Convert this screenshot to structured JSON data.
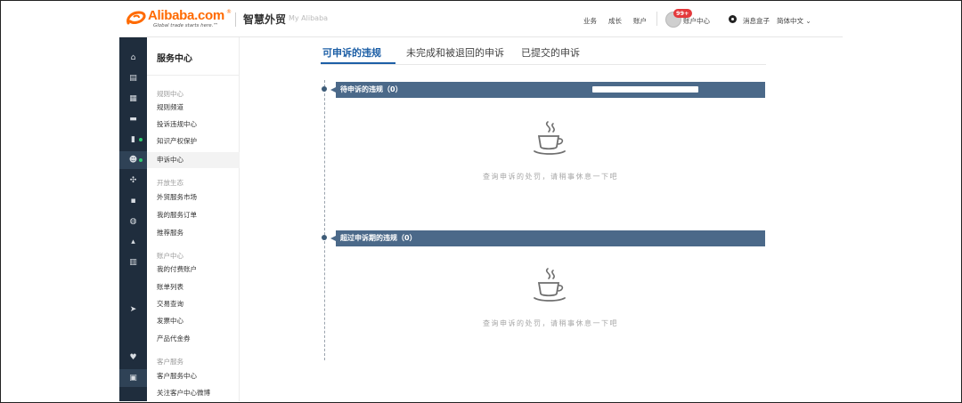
{
  "header": {
    "logo_word": "Alibaba.com",
    "logo_sup": "®",
    "logo_slogan": "Global trade starts here.™",
    "brand": "智慧外贸",
    "sub_brand": "My Alibaba",
    "nav": [
      "业务",
      "成长",
      "账户"
    ],
    "badge": "99+",
    "account_center": "账户中心",
    "messages": "消息盒子",
    "language": "简体中文"
  },
  "rail": {
    "icons": [
      "home-icon",
      "box-icon",
      "grid-icon",
      "chat-icon",
      "chart-icon",
      "users-icon",
      "share-icon",
      "clipboard-icon",
      "globe-icon",
      "store-icon",
      "bank-icon",
      "send-icon",
      "heart-icon",
      "bag-icon"
    ]
  },
  "sidebar": {
    "title": "服务中心",
    "groups": [
      {
        "label": "规则中心",
        "items": [
          "规则频道",
          "投诉违规中心",
          "知识产权保护",
          "申诉中心"
        ]
      },
      {
        "label": "开放生态",
        "items": [
          "外贸服务市场",
          "我的服务订单",
          "推荐服务"
        ]
      },
      {
        "label": "账户中心",
        "items": [
          "我的付费账户",
          "账单列表",
          "交易查询",
          "发票中心",
          "产品代金券"
        ]
      },
      {
        "label": "客户服务",
        "items": [
          "客户服务中心",
          "关注客户中心微博"
        ]
      }
    ],
    "active_item": "申诉中心"
  },
  "tabs": [
    {
      "label": "可申诉的违规",
      "active": true
    },
    {
      "label": "未完成和被退回的申诉",
      "active": false
    },
    {
      "label": "已提交的申诉",
      "active": false
    }
  ],
  "sections": [
    {
      "title": "待申诉的违规（0）",
      "empty_text": "查询申诉的处罚，请稍事休息一下吧"
    },
    {
      "title": "超过申诉期的违规（0）",
      "empty_text": "查询申诉的处罚，请稍事休息一下吧"
    }
  ],
  "colors": {
    "accent": "#1d5fa6",
    "section_bar": "#4b6989",
    "rail_bg": "#1f2d3d",
    "brand_orange": "#ff6a00"
  }
}
